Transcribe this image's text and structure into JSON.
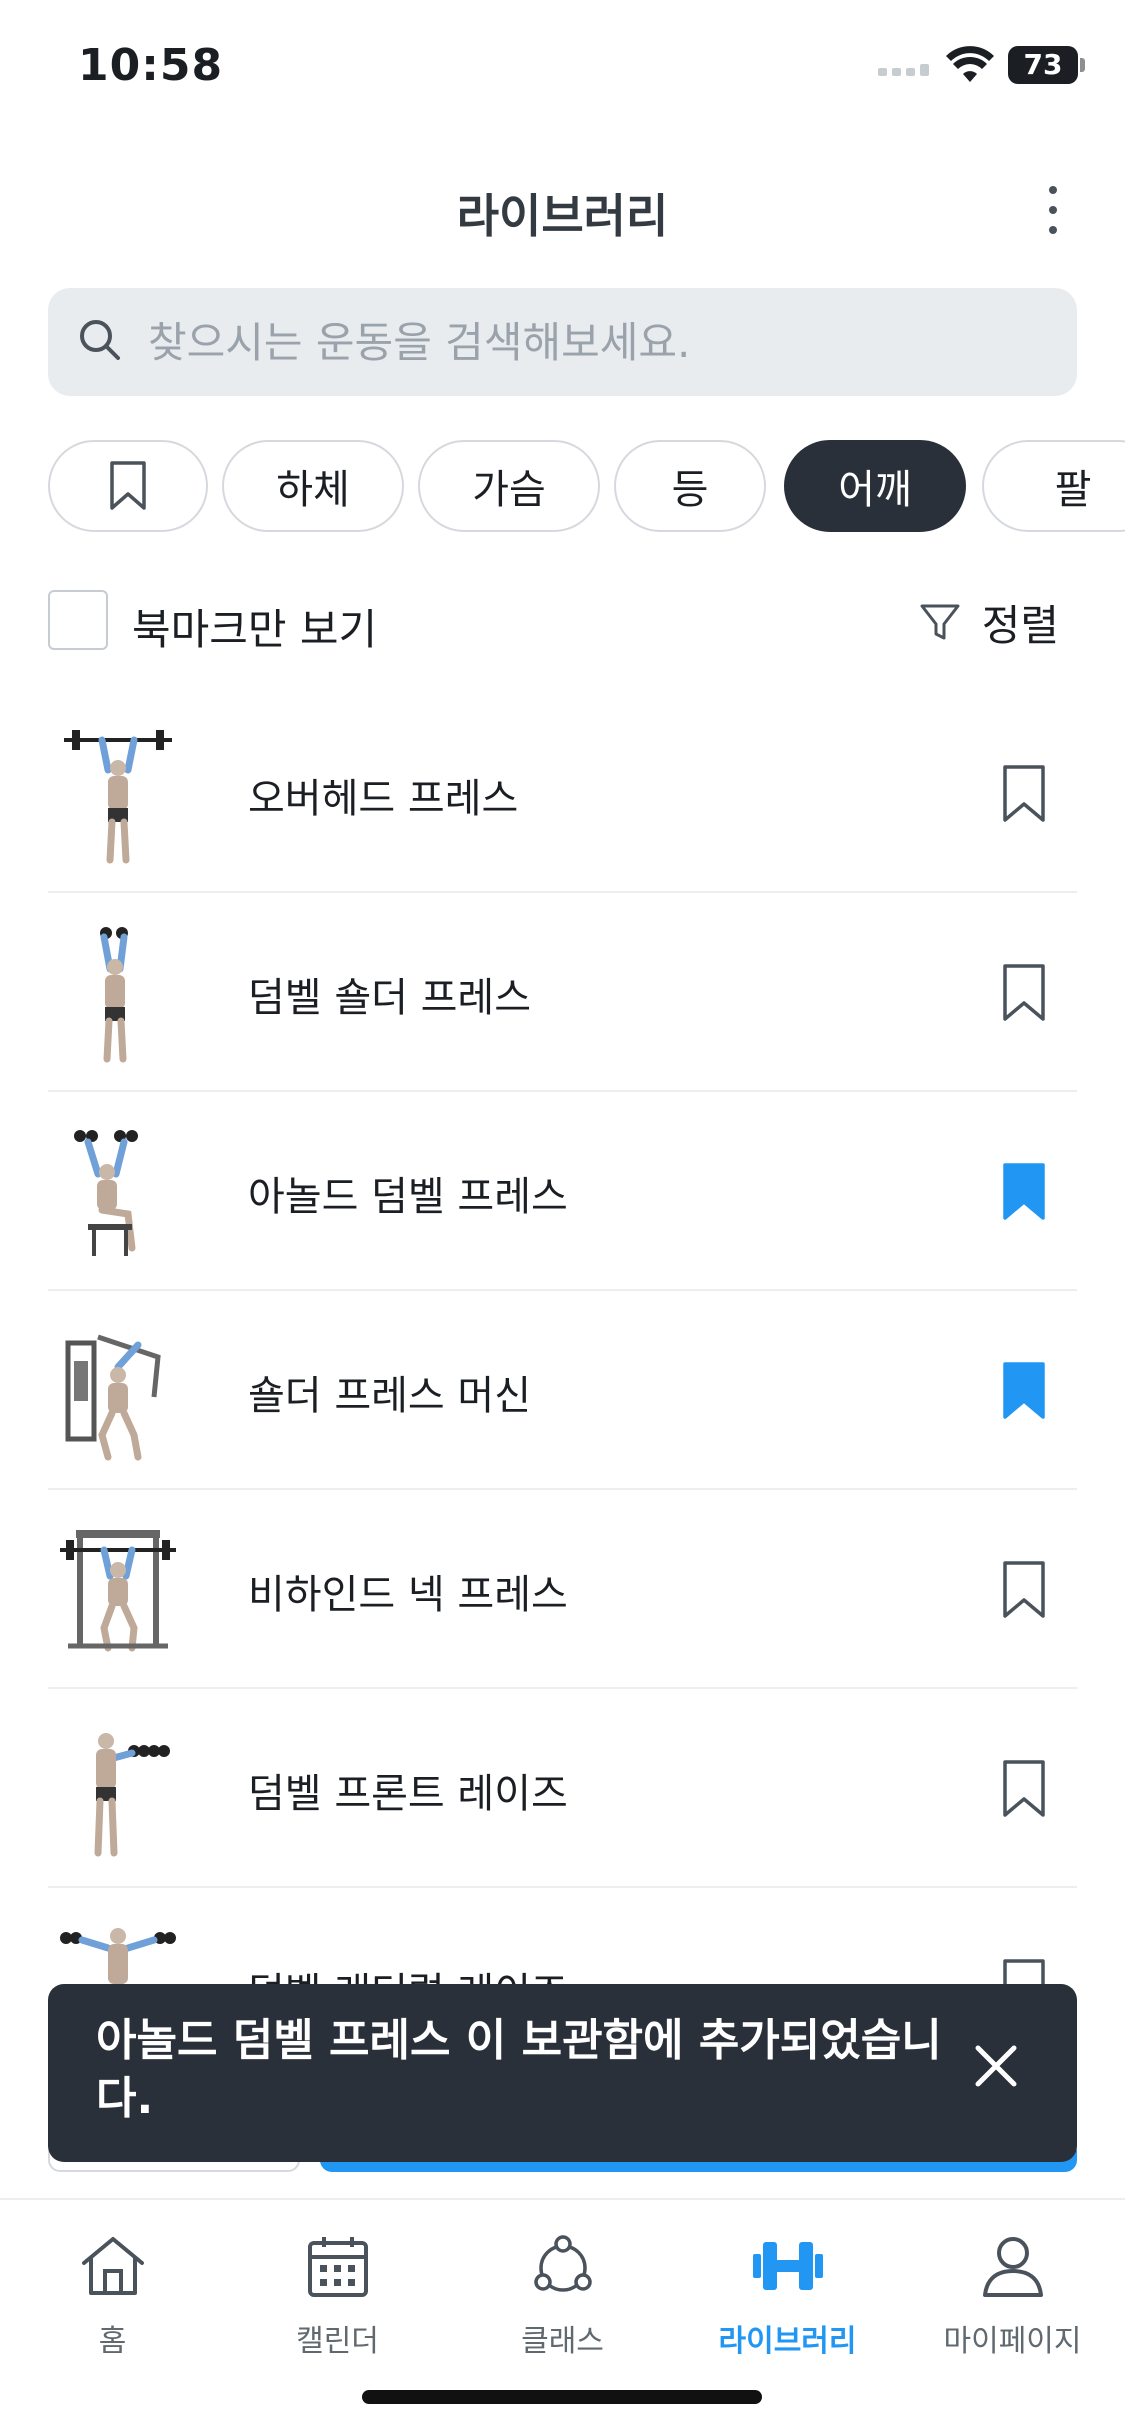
{
  "status_bar": {
    "time": "10:58",
    "battery": "73"
  },
  "header": {
    "title": "라이브러리"
  },
  "search": {
    "placeholder": "찾으시는 운동을 검색해보세요."
  },
  "chips": [
    {
      "label": "",
      "icon": "bookmark-icon"
    },
    {
      "label": "하체"
    },
    {
      "label": "가슴"
    },
    {
      "label": "등"
    },
    {
      "label": "어깨",
      "active": true
    },
    {
      "label": "팔"
    }
  ],
  "filter": {
    "bookmark_only_label": "북마크만 보기",
    "bookmark_only_checked": false,
    "sort_label": "정렬"
  },
  "exercises": [
    {
      "name": "오버헤드 프레스",
      "bookmarked": false
    },
    {
      "name": "덤벨 숄더 프레스",
      "bookmarked": false
    },
    {
      "name": "아놀드 덤벨 프레스",
      "bookmarked": true
    },
    {
      "name": "숄더 프레스 머신",
      "bookmarked": true
    },
    {
      "name": "비하인드 넥 프레스",
      "bookmarked": false
    },
    {
      "name": "덤벨 프론트 레이즈",
      "bookmarked": false
    },
    {
      "name": "덤벨 래터럴 레이즈",
      "bookmarked": false
    }
  ],
  "toast": {
    "message": "아놀드 덤벨 프레스 이 보관함에 추가되었습니다."
  },
  "tabbar": [
    {
      "label": "홈",
      "icon": "home-icon"
    },
    {
      "label": "캘린더",
      "icon": "calendar-icon"
    },
    {
      "label": "클래스",
      "icon": "class-icon"
    },
    {
      "label": "라이브러리",
      "icon": "dumbbell-icon",
      "active": true
    },
    {
      "label": "마이페이지",
      "icon": "person-icon"
    }
  ],
  "colors": {
    "accent": "#2196f3",
    "dark": "#2a3039",
    "chip_border": "#d5d9de"
  }
}
